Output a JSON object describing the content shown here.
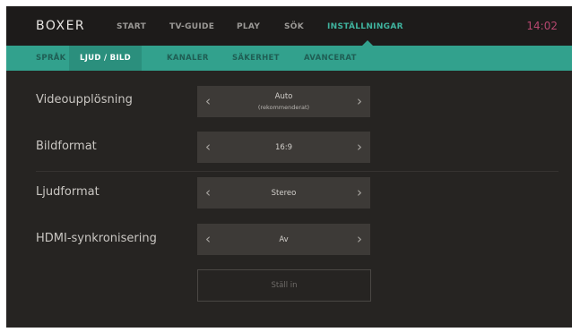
{
  "header": {
    "logo": "BOXER",
    "nav": [
      "START",
      "TV-GUIDE",
      "PLAY",
      "SÖK",
      "INSTÄLLNINGAR"
    ],
    "active_nav": "INSTÄLLNINGAR",
    "clock": "14:02"
  },
  "tabs": {
    "items": [
      "SPRÅK",
      "LJUD / BILD",
      "KANALER",
      "SÄKERHET",
      "AVANCERAT"
    ],
    "active": "LJUD / BILD"
  },
  "settings": [
    {
      "label": "Videoupplösning",
      "value": "Auto",
      "sub": "(rekommenderat)"
    },
    {
      "label": "Bildformat",
      "value": "16:9"
    },
    {
      "label": "Ljudformat",
      "value": "Stereo"
    },
    {
      "label": "HDMI-synkronisering",
      "value": "Av"
    }
  ],
  "arrows": {
    "left": "‹",
    "right": "›"
  },
  "apply_button": "Ställ in",
  "colors": {
    "accent": "#32a18d",
    "active_nav": "#3fb39e",
    "clock": "#b5476f",
    "background": "#262422"
  }
}
